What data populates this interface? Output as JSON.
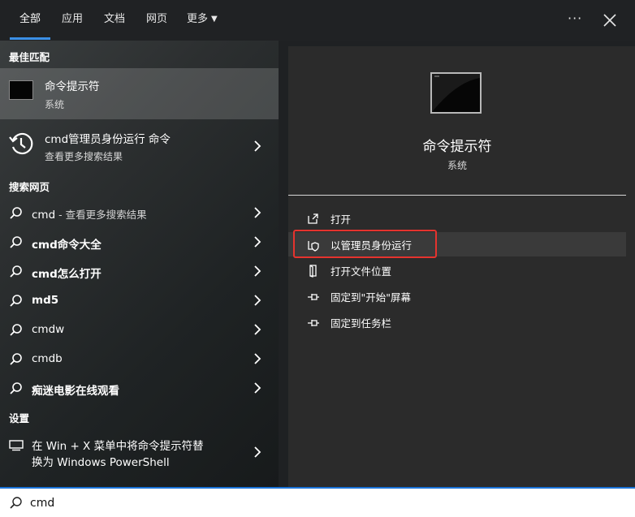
{
  "tabs": [
    {
      "label": "全部",
      "active": true
    },
    {
      "label": "应用"
    },
    {
      "label": "文档"
    },
    {
      "label": "网页"
    },
    {
      "label": "更多"
    }
  ],
  "topbar": {
    "more_icon": "ellipsis-icon",
    "close_icon": "close-icon"
  },
  "left": {
    "best_match_label": "最佳匹配",
    "best_match": {
      "title": "命令提示符",
      "subtitle": "系统",
      "icon": "terminal-icon"
    },
    "history": {
      "title": "cmd管理员身份运行 命令",
      "subtitle": "查看更多搜索结果",
      "icon": "history-icon"
    },
    "web_label": "搜索网页",
    "web_items": [
      {
        "query": "cmd",
        "suffix": " - 查看更多搜索结果"
      },
      {
        "query": "cmd命令大全",
        "suffix": ""
      },
      {
        "query": "cmd怎么打开",
        "suffix": ""
      },
      {
        "query": "md5",
        "suffix": ""
      },
      {
        "query": "cmdw",
        "suffix": ""
      },
      {
        "query": "cmdb",
        "suffix": ""
      },
      {
        "query": "痴迷电影在线观看",
        "suffix": ""
      }
    ],
    "settings_label": "设置",
    "settings_item": {
      "line1": "在 Win + X 菜单中将命令提示符替",
      "line2": "换为 Windows PowerShell",
      "icon": "monitor-icon"
    }
  },
  "right": {
    "app_title": "命令提示符",
    "app_subtitle": "系统",
    "actions": [
      {
        "label": "打开",
        "icon": "open-icon"
      },
      {
        "label": "以管理员身份运行",
        "icon": "shield-icon"
      },
      {
        "label": "打开文件位置",
        "icon": "folder-icon"
      },
      {
        "label": "固定到\"开始\"屏幕",
        "icon": "pin-icon"
      },
      {
        "label": "固定到任务栏",
        "icon": "pin-icon"
      }
    ]
  },
  "search": {
    "value": "cmd",
    "icon": "search-icon"
  },
  "colors": {
    "accent": "#3b8fe6",
    "highlight": "#e5332e"
  }
}
